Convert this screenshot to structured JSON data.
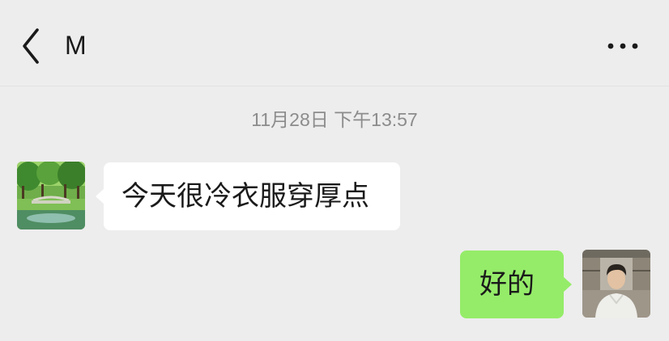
{
  "header": {
    "contact_name": "M",
    "back_icon": "chevron-left-icon",
    "more_icon": "more-horizontal-icon"
  },
  "chat": {
    "timestamp": "11月28日 下午13:57",
    "messages": [
      {
        "direction": "incoming",
        "text": "今天很冷衣服穿厚点",
        "avatar": "park-landscape-avatar"
      },
      {
        "direction": "outgoing",
        "text": "好的",
        "avatar": "user-photo-avatar"
      }
    ]
  },
  "colors": {
    "background": "#ededed",
    "incoming_bubble": "#ffffff",
    "outgoing_bubble": "#95ec69",
    "timestamp_text": "#8c8c8c",
    "primary_text": "#1a1a1a"
  }
}
